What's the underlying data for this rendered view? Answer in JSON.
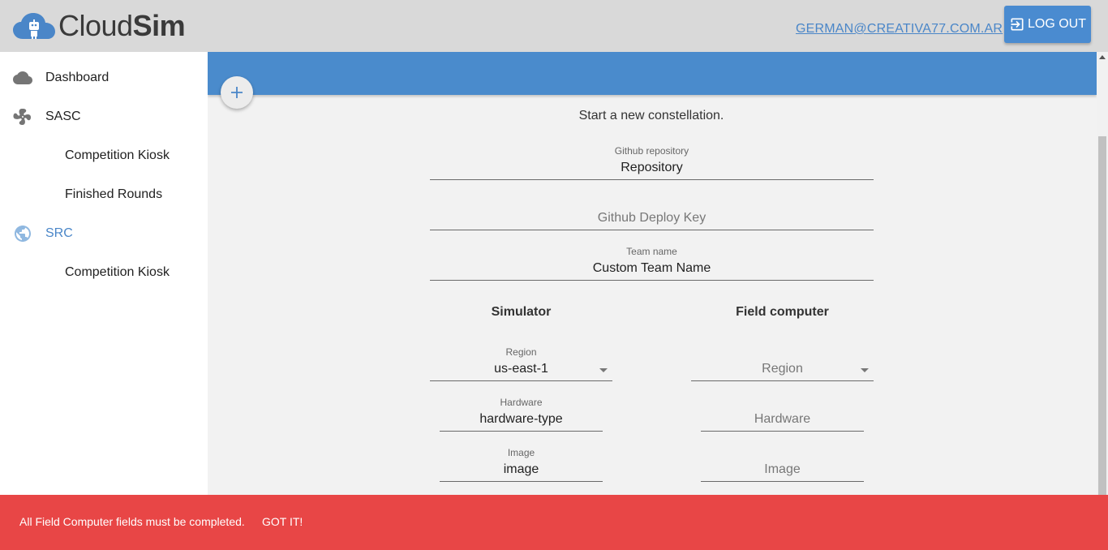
{
  "header": {
    "logo_light": "Cloud",
    "logo_bold": "Sim",
    "user_email": "GERMAN@CREATIVA77.COM.AR",
    "logout_label": "LOG OUT",
    "logout_icon": "exit-to-app-icon"
  },
  "sidebar": {
    "items": [
      {
        "label": "Dashboard",
        "icon": "cloud-icon"
      },
      {
        "label": "SASC",
        "icon": "fan-icon"
      },
      {
        "label": "Competition Kiosk"
      },
      {
        "label": "Finished Rounds"
      },
      {
        "label": "SRC",
        "icon": "globe-icon",
        "active": true
      },
      {
        "label": "Competition Kiosk"
      }
    ]
  },
  "main": {
    "fab_icon": "plus-icon",
    "intro": "Start a new constellation.",
    "github_repo": {
      "label": "Github repository",
      "value": "Repository"
    },
    "deploy_key": {
      "placeholder": "Github Deploy Key"
    },
    "team_name": {
      "label": "Team name",
      "value": "Custom Team Name"
    },
    "simulator": {
      "title": "Simulator",
      "region": {
        "label": "Region",
        "value": "us-east-1"
      },
      "hardware": {
        "label": "Hardware",
        "value": "hardware-type"
      },
      "image": {
        "label": "Image",
        "value": "image"
      }
    },
    "field_computer": {
      "title": "Field computer",
      "region": {
        "placeholder": "Region"
      },
      "hardware": {
        "placeholder": "Hardware"
      },
      "image": {
        "placeholder": "Image"
      }
    }
  },
  "snackbar": {
    "message": "All Field Computer fields must be completed.",
    "action": "GOT IT!"
  },
  "colors": {
    "header_bg": "#d9d9d9",
    "accent": "#4a8bcc",
    "link": "#4a86c8",
    "snackbar_bg": "#e84646"
  }
}
